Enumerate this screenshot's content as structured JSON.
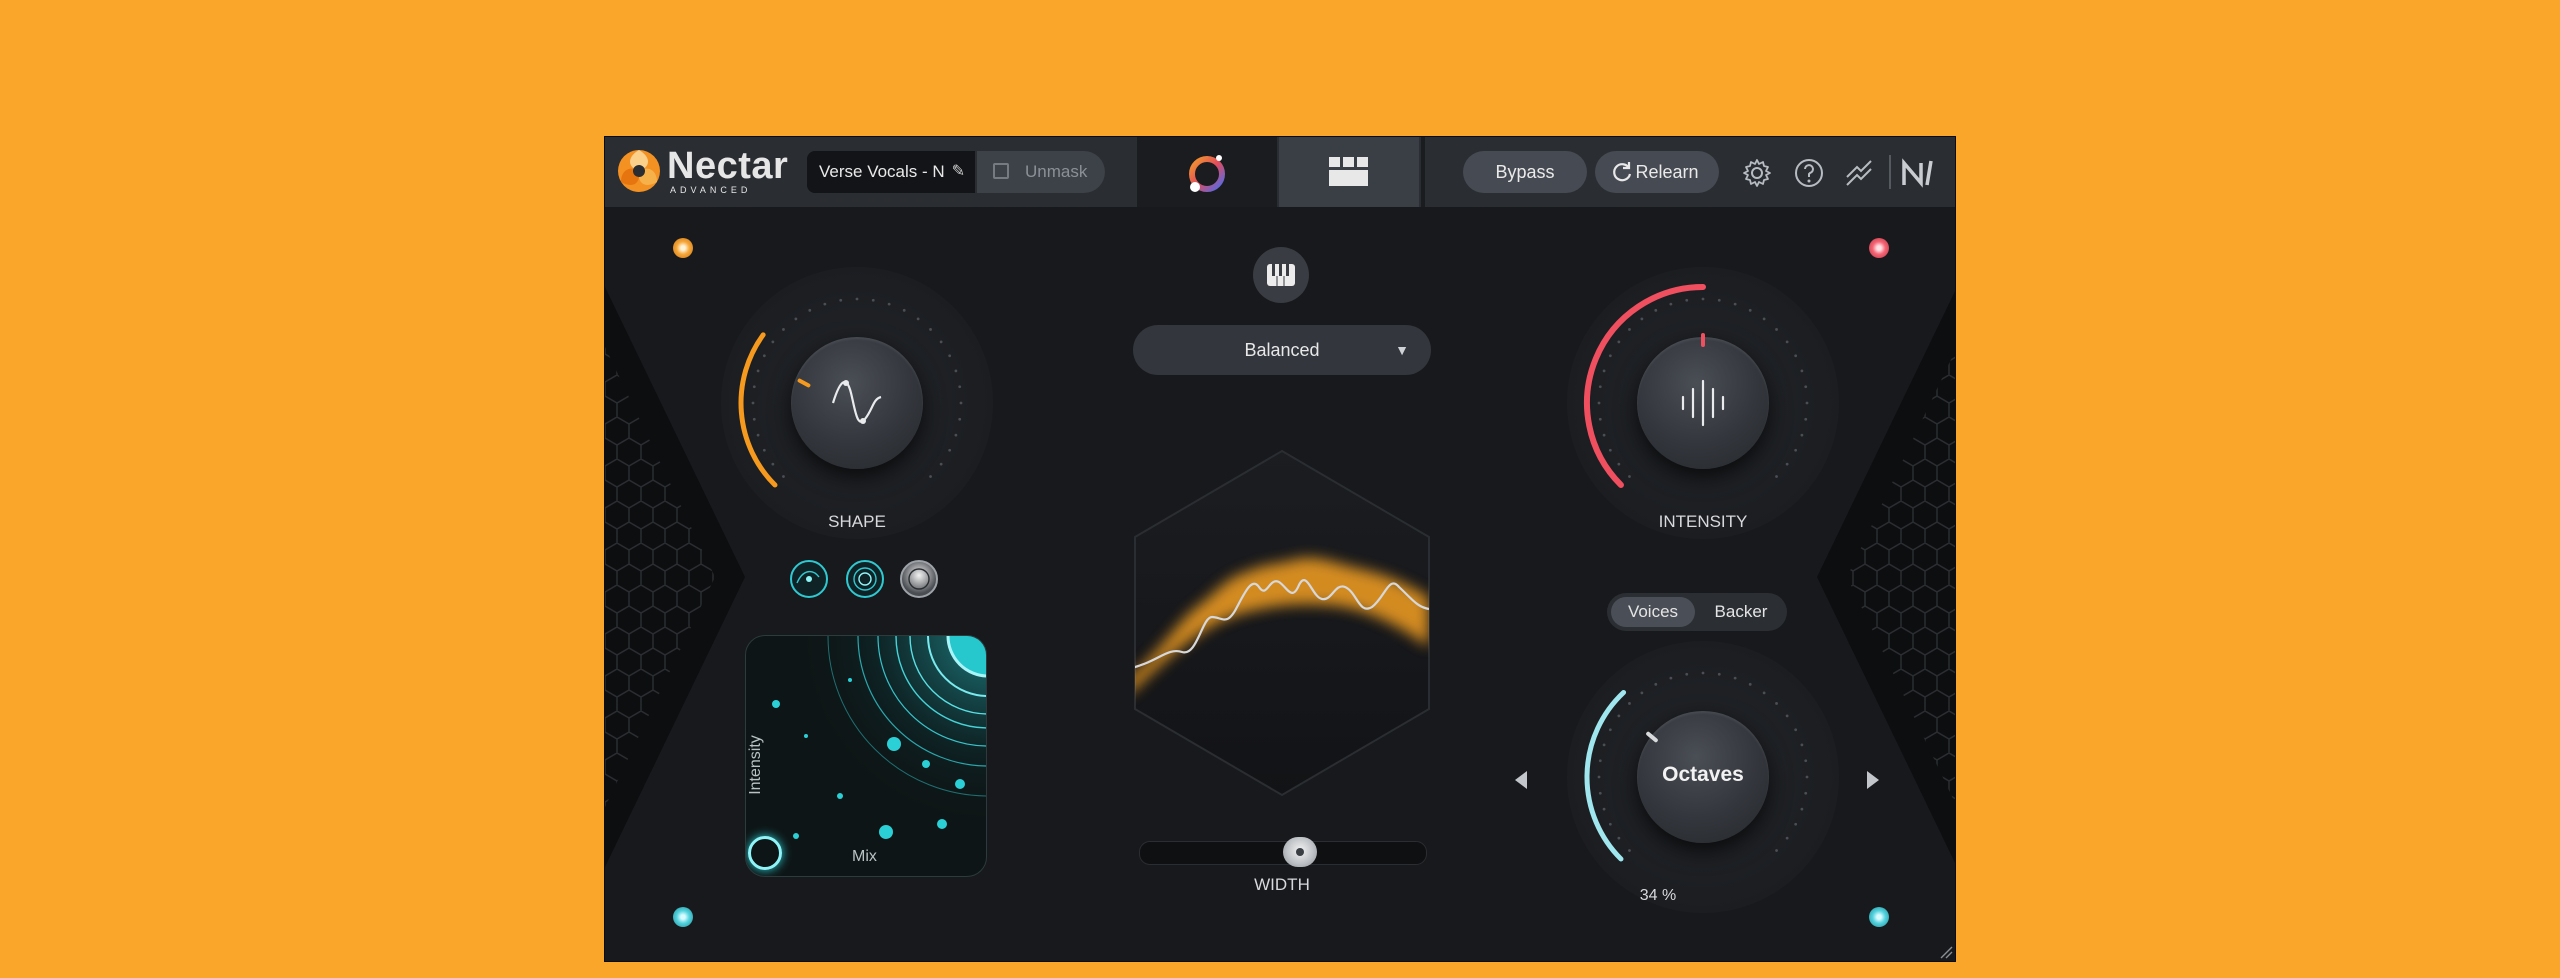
{
  "colors": {
    "background": "#f9a62b",
    "panel": "#17191c",
    "shape_accent": "#f59a1e",
    "intensity_accent": "#f04f5f",
    "voice_accent": "#9fe6ee",
    "pad_accent": "#2ad0d6"
  },
  "header": {
    "logo_title": "Nectar",
    "logo_subtitle": "ADVANCED",
    "preset_name": "Verse Vocals - N",
    "unmask_label": "Unmask",
    "bypass_label": "Bypass",
    "relearn_label": "Relearn",
    "icons": [
      "nectar-logo-icon",
      "pencil-icon",
      "unmask-icon",
      "assistant-orb-icon",
      "modules-grid-icon",
      "refresh-icon",
      "gear-icon",
      "help-icon",
      "link-icon",
      "ni-logo-icon"
    ]
  },
  "shape": {
    "label": "SHAPE",
    "level": 0.3
  },
  "mode_buttons": [
    "mode-1-icon",
    "mode-2-icon",
    "mode-3-icon"
  ],
  "pad": {
    "x_label": "Mix",
    "y_label": "Intensity"
  },
  "center": {
    "keyboard_icon": "piano-icon",
    "style_value": "Balanced",
    "width_label": "WIDTH",
    "width_value": 0.57
  },
  "intensity": {
    "label": "INTENSITY",
    "level": 0.5
  },
  "voices_toggle": {
    "options": [
      "Voices",
      "Backer"
    ],
    "selected": "Voices"
  },
  "voice_knob": {
    "value_label": "Octaves",
    "percent": "34 %",
    "level": 0.34
  }
}
